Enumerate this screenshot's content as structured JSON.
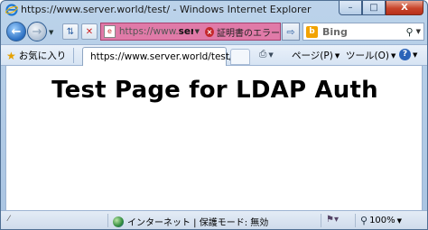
{
  "window": {
    "title": "https://www.server.world/test/ - Windows Internet Explorer",
    "minimize": "–",
    "maximize": "□",
    "close": "X"
  },
  "address_bar": {
    "url_gray": "https://www.",
    "url_bold": "ser",
    "cert_error": "証明書のエラー",
    "search_engine": "Bing"
  },
  "toolbar": {
    "favorites": "お気に入り",
    "tab_title": "https://www.server.world/test/",
    "page_menu": "ページ(P)",
    "tools_menu": "ツール(O)"
  },
  "content": {
    "heading": "Test Page for LDAP Auth"
  },
  "status_bar": {
    "zone": "インターネット | 保護モード: 無効",
    "zoom": "100%"
  },
  "colors": {
    "cert_error_bar": "#e07aa8",
    "frame": "#bcd3ea"
  },
  "icons": [
    "ie-logo-icon",
    "back-icon",
    "forward-icon",
    "compat-view-icon",
    "stop-icon",
    "certificate-error-icon",
    "go-icon",
    "bing-icon",
    "search-icon",
    "favorites-star-icon",
    "tab-page-icon",
    "print-icon",
    "help-icon",
    "globe-icon",
    "protected-mode-icon",
    "zoom-icon"
  ]
}
